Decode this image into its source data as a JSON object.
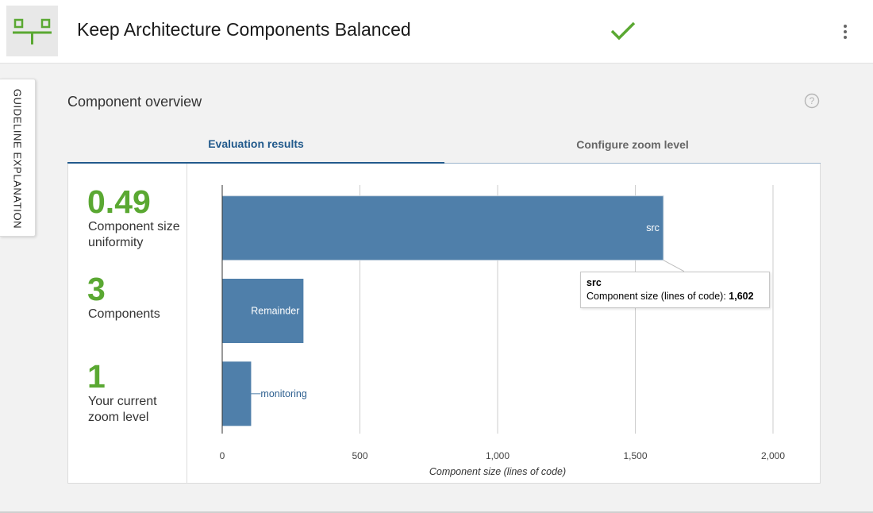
{
  "header": {
    "title": "Keep Architecture Components Balanced",
    "accent_color": "#5aa832",
    "logo_icon": "component-balance-icon",
    "status_icon": "check-icon",
    "menu_icon": "more-vert-icon"
  },
  "sidebar_tab": {
    "label": "GUIDELINE EXPLANATION"
  },
  "section": {
    "title": "Component overview",
    "help_icon": "help-circle-icon"
  },
  "tabs": [
    {
      "label": "Evaluation results",
      "active": true
    },
    {
      "label": "Configure zoom level",
      "active": false
    }
  ],
  "stats": [
    {
      "value": "0.49",
      "label": "Component size uniformity"
    },
    {
      "value": "3",
      "label": "Components"
    },
    {
      "value": "1",
      "label": "Your current zoom level"
    }
  ],
  "tooltip": {
    "title": "src",
    "label": "Component size (lines of code)",
    "value": "1,602"
  },
  "chart_data": {
    "type": "bar",
    "orientation": "horizontal",
    "categories": [
      "src",
      "Remainder",
      "monitoring"
    ],
    "values": [
      1602,
      295,
      105
    ],
    "xlabel": "Component size (lines of code)",
    "xlim": [
      0,
      2000
    ],
    "xticks": [
      0,
      500,
      1000,
      1500,
      2000
    ],
    "xtick_labels": [
      "0",
      "500",
      "1,000",
      "1,500",
      "2,000"
    ],
    "grid": true,
    "bar_color": "#4f7faa"
  }
}
